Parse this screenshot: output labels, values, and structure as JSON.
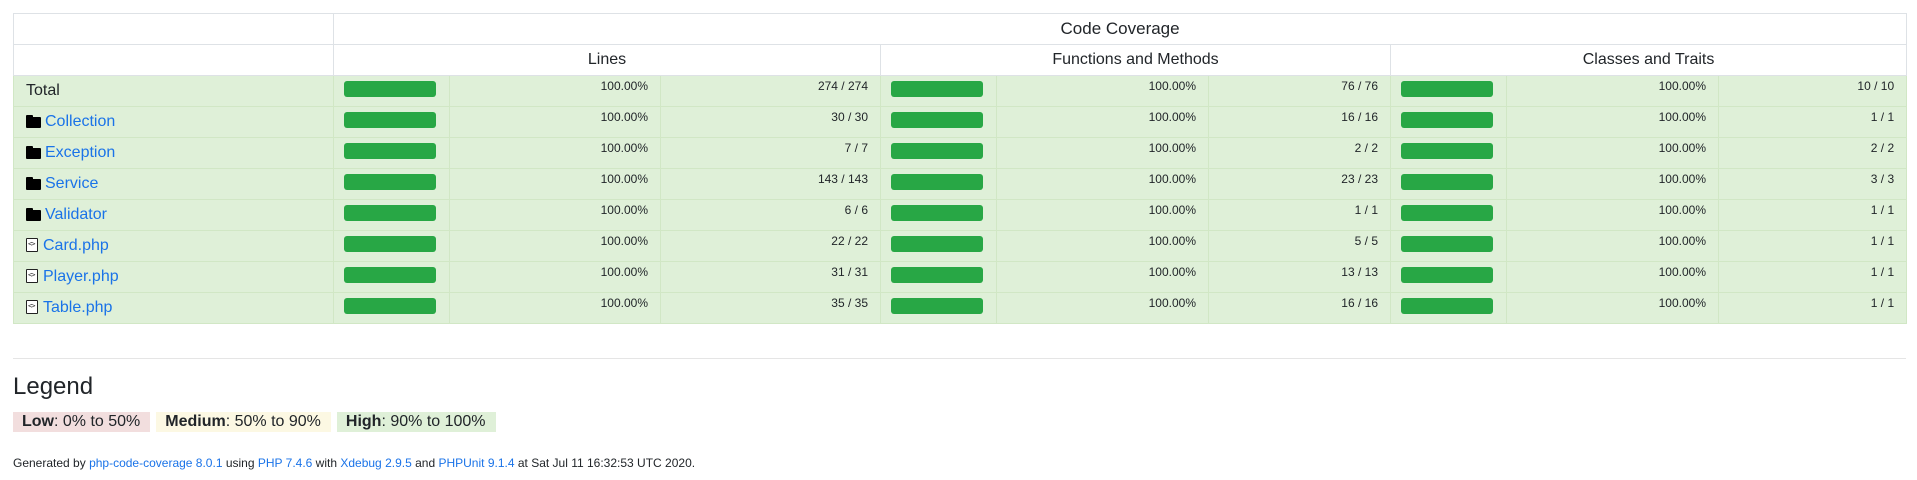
{
  "table": {
    "header_title": "Code Coverage",
    "columns": [
      "Lines",
      "Functions and Methods",
      "Classes and Traits"
    ],
    "rows": [
      {
        "name": "Total",
        "type": "total",
        "lines_pct": "100.00%",
        "lines": "274 / 274",
        "funcs_pct": "100.00%",
        "funcs": "76 / 76",
        "classes_pct": "100.00%",
        "classes": "10 / 10"
      },
      {
        "name": "Collection",
        "type": "dir",
        "lines_pct": "100.00%",
        "lines": "30 / 30",
        "funcs_pct": "100.00%",
        "funcs": "16 / 16",
        "classes_pct": "100.00%",
        "classes": "1 / 1"
      },
      {
        "name": "Exception",
        "type": "dir",
        "lines_pct": "100.00%",
        "lines": "7 / 7",
        "funcs_pct": "100.00%",
        "funcs": "2 / 2",
        "classes_pct": "100.00%",
        "classes": "2 / 2"
      },
      {
        "name": "Service",
        "type": "dir",
        "lines_pct": "100.00%",
        "lines": "143 / 143",
        "funcs_pct": "100.00%",
        "funcs": "23 / 23",
        "classes_pct": "100.00%",
        "classes": "3 / 3"
      },
      {
        "name": "Validator",
        "type": "dir",
        "lines_pct": "100.00%",
        "lines": "6 / 6",
        "funcs_pct": "100.00%",
        "funcs": "1 / 1",
        "classes_pct": "100.00%",
        "classes": "1 / 1"
      },
      {
        "name": "Card.php",
        "type": "file",
        "lines_pct": "100.00%",
        "lines": "22 / 22",
        "funcs_pct": "100.00%",
        "funcs": "5 / 5",
        "classes_pct": "100.00%",
        "classes": "1 / 1"
      },
      {
        "name": "Player.php",
        "type": "file",
        "lines_pct": "100.00%",
        "lines": "31 / 31",
        "funcs_pct": "100.00%",
        "funcs": "13 / 13",
        "classes_pct": "100.00%",
        "classes": "1 / 1"
      },
      {
        "name": "Table.php",
        "type": "file",
        "lines_pct": "100.00%",
        "lines": "35 / 35",
        "funcs_pct": "100.00%",
        "funcs": "16 / 16",
        "classes_pct": "100.00%",
        "classes": "1 / 1"
      }
    ]
  },
  "colors": {
    "high_bg": "#dff0d8",
    "bar_fill": "#28a745",
    "link": "#1a73e8",
    "low_bg": "#f2dede",
    "medium_bg": "#fcf8e3"
  },
  "legend": {
    "title": "Legend",
    "low_label": "Low",
    "low_range": ": 0% to 50%",
    "medium_label": "Medium",
    "medium_range": ": 50% to 90%",
    "high_label": "High",
    "high_range": ": 90% to 100%"
  },
  "footer": {
    "generated_by": "Generated by ",
    "tool_link": "php-code-coverage 8.0.1",
    "using": " using ",
    "php_link": "PHP 7.4.6",
    "with": " with ",
    "xdebug_link": "Xdebug 2.9.5",
    "and": " and ",
    "phpunit_link": "PHPUnit 9.1.4",
    "at": " at Sat Jul 11 16:32:53 UTC 2020."
  }
}
